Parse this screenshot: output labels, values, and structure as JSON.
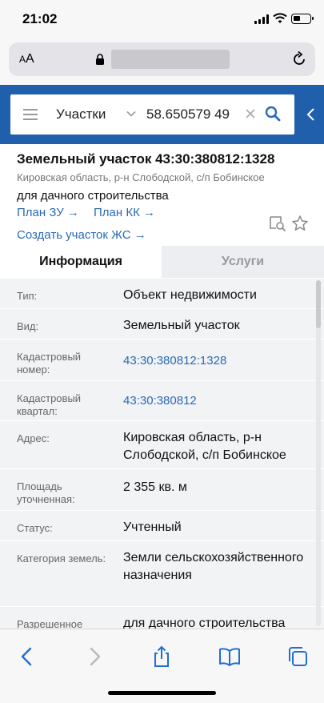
{
  "status_bar": {
    "time": "21:02"
  },
  "safari": {
    "text_size_label": "AA"
  },
  "search": {
    "type": "Участки",
    "query": "58.650579 49"
  },
  "parcel": {
    "title": "Земельный участок 43:30:380812:1328",
    "address_short": "Кировская область, р-н Слободской, с/п Бобинское",
    "purpose": "для дачного строительства",
    "links": {
      "plan_zu": "План ЗУ",
      "plan_kk": "План КК",
      "create_zhs": "Создать участок ЖС"
    }
  },
  "tabs": {
    "info": "Информация",
    "services": "Услуги"
  },
  "properties": [
    {
      "label": "Тип:",
      "value": "Объект недвижимости"
    },
    {
      "label": "Вид:",
      "value": "Земельный участок"
    },
    {
      "label": "Кадастровый номер:",
      "value": "43:30:380812:1328",
      "link": true
    },
    {
      "label": "Кадастровый квартал:",
      "value": "43:30:380812",
      "link": true
    },
    {
      "label": "Адрес:",
      "value": "Кировская область, р-н Слободской, с/п Бобинское"
    },
    {
      "label": "Площадь уточненная:",
      "value": "2 355 кв. м"
    },
    {
      "label": "Статус:",
      "value": "Учтенный"
    },
    {
      "label": "Категория земель:",
      "value": "Земли сельскохозяйственного назначения"
    },
    {
      "label": "Разрешенное использование:",
      "value": "для дачного строительства"
    }
  ],
  "colors": {
    "header_blue": "#1f5fab",
    "link_blue": "#2a6ab6",
    "table_bg": "#f2f3f5"
  },
  "icons": [
    "cellular-signal-icon",
    "wifi-icon",
    "battery-icon",
    "lock-icon",
    "reload-icon",
    "hamburger-icon",
    "chevron-down-icon",
    "clear-icon",
    "search-icon",
    "collapse-icon",
    "map-search-icon",
    "star-icon",
    "back-icon",
    "forward-icon",
    "share-icon",
    "bookmarks-icon",
    "tabs-icon"
  ]
}
